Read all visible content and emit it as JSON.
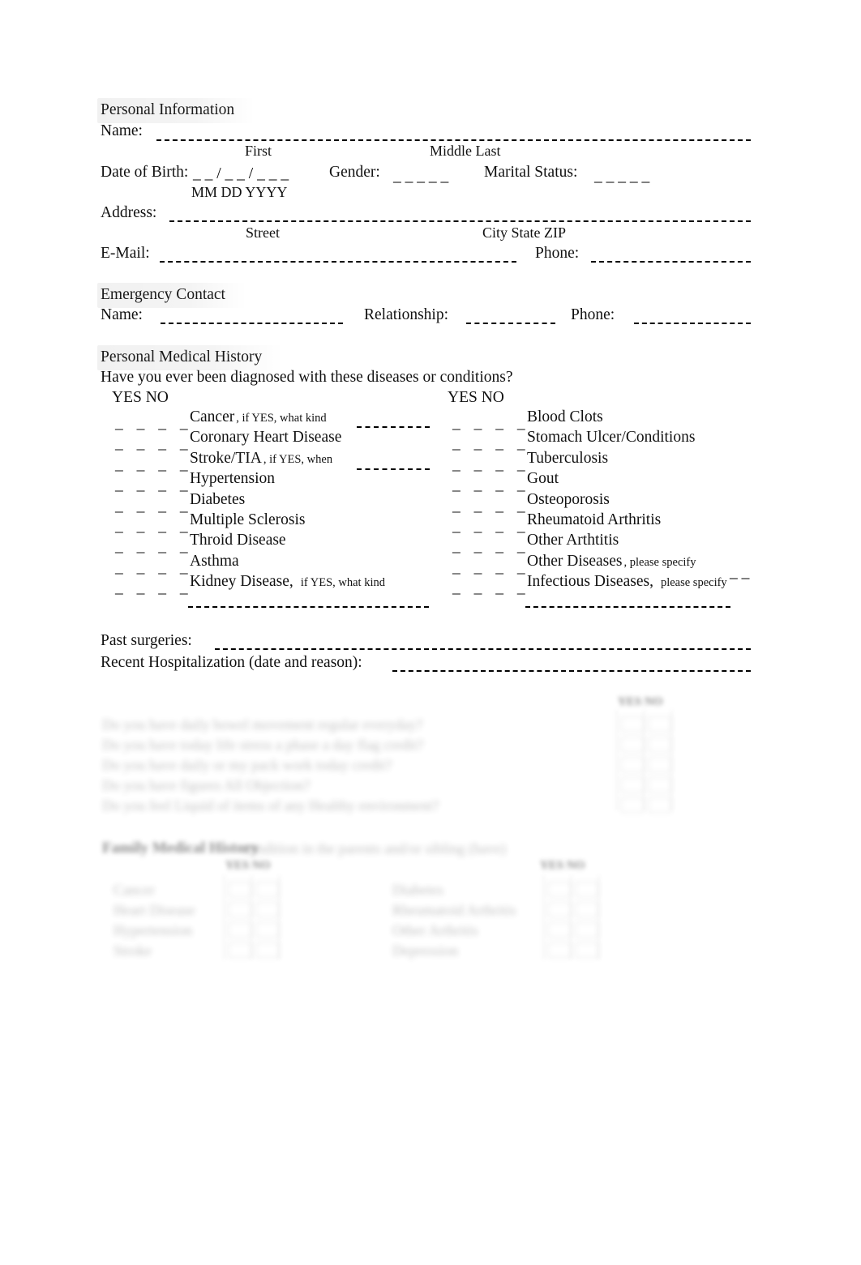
{
  "document": {
    "type": "medical-intake-form"
  },
  "personal_information": {
    "heading": "Personal Information",
    "name_label": "Name:",
    "name_sub_first": "First",
    "name_sub_middle_last": "Middle Last",
    "dob_label": "Date of Birth:",
    "dob_blank": "_  _ /  _  _ /  _   _   _",
    "dob_sub": "MM DD YYYY",
    "gender_label": "Gender:",
    "gender_blank": "_   _   _   _   _",
    "marital_label": "Marital Status:",
    "marital_blank": "_   _   _   _   _",
    "address_label": "Address:",
    "address_sub_street": "Street",
    "address_sub_city": "City State ZIP",
    "email_label": "E-Mail:",
    "phone_label": "Phone:"
  },
  "emergency_contact": {
    "heading": "Emergency Contact",
    "name_label": "Name:",
    "relationship_label": "Relationship:",
    "phone_label": "Phone:"
  },
  "medical_history": {
    "heading": "Personal Medical History",
    "question": "Have you ever been diagnosed with these diseases or conditions?",
    "yes_no_header": "YES NO",
    "checkbox_marks": "_  _    _  _",
    "left_items": [
      {
        "label": "Cancer",
        "note": ", if YES, what kind",
        "has_inline_blank": true
      },
      {
        "label": "Coronary Heart Disease",
        "note": "",
        "has_inline_blank": false
      },
      {
        "label": "Stroke/TIA",
        "note": ", if YES, when",
        "has_inline_blank": true
      },
      {
        "label": "Hypertension",
        "note": "",
        "has_inline_blank": false
      },
      {
        "label": "Diabetes",
        "note": "",
        "has_inline_blank": false
      },
      {
        "label": "Multiple Sclerosis",
        "note": "",
        "has_inline_blank": false
      },
      {
        "label": "Throid Disease",
        "note": "",
        "has_inline_blank": false
      },
      {
        "label": "Asthma",
        "note": "",
        "has_inline_blank": false
      },
      {
        "label": "Kidney Disease,",
        "note": "if YES, what kind",
        "has_inline_blank": false
      }
    ],
    "right_items": [
      {
        "label": "Blood Clots",
        "note": "",
        "has_inline_blank": false
      },
      {
        "label": "Stomach Ulcer/Conditions",
        "note": "",
        "has_inline_blank": false
      },
      {
        "label": "Tuberculosis",
        "note": "",
        "has_inline_blank": false
      },
      {
        "label": "Gout",
        "note": "",
        "has_inline_blank": false
      },
      {
        "label": "Osteoporosis",
        "note": "",
        "has_inline_blank": false
      },
      {
        "label": "Rheumatoid Arthritis",
        "note": "",
        "has_inline_blank": false
      },
      {
        "label": "Other Arthtitis",
        "note": "",
        "has_inline_blank": false
      },
      {
        "label": "Other Diseases",
        "note": ", please specify",
        "has_inline_blank": true
      },
      {
        "label": "Infectious Diseases,",
        "note": "please specify",
        "has_inline_blank": false
      }
    ],
    "inline_blank_short": "_  _"
  },
  "history_details": {
    "past_surgeries_label": "Past surgeries:",
    "recent_hospitalization_label": "Recent Hospitalization (date and reason):"
  },
  "faded_lifestyle_section": {
    "yes_no_header": "YES NO",
    "lines": [
      "Do you have daily bowel movement regular everyday?",
      "Do you have today life stress a phase a day flag credit?",
      "Do you have daily or my pack work today credit?",
      "Do you have figures All Objection?",
      "Do you feel Liquid of items of any Healthy environment?"
    ]
  },
  "faded_family_section": {
    "heading": "Family Medical History",
    "intro": "condition in the parents and/or sibling (have)",
    "yes_no_left": "YES NO",
    "yes_no_right": "YES NO",
    "left_items": [
      "Cancer",
      "Heart Disease",
      "Hypertension",
      "Stroke"
    ],
    "right_items": [
      "Diabetes",
      "Rheumatoid Arthritis",
      "Other Arthritis",
      "Depression"
    ]
  },
  "colors": {
    "ink": "#111111",
    "paper": "#ffffff",
    "rule": "#000000",
    "heading_halo": "rgba(0,0,0,0.055)"
  }
}
